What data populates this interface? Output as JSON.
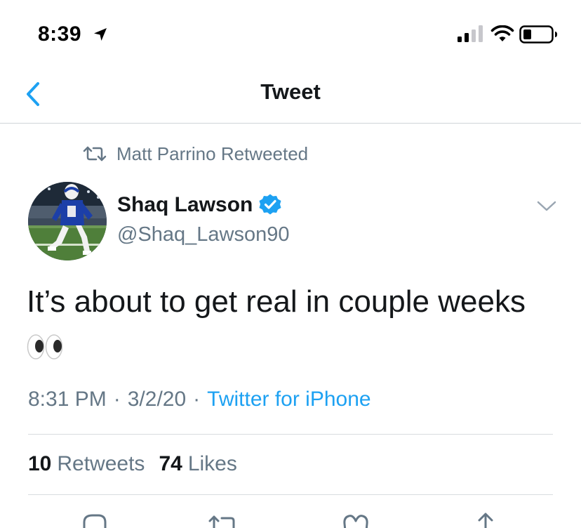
{
  "status_bar": {
    "time": "8:39"
  },
  "nav": {
    "title": "Tweet"
  },
  "retweet_context": {
    "text": "Matt Parrino Retweeted"
  },
  "tweet": {
    "author_name": "Shaq Lawson",
    "author_handle": "@Shaq_Lawson90",
    "text": "It’s about to get real in couple weeks",
    "emoji": "👀",
    "time": "8:31 PM",
    "separator": "·",
    "date": "3/2/20",
    "source": "Twitter for iPhone"
  },
  "stats": {
    "retweets_count": "10",
    "retweets_label": "Retweets",
    "likes_count": "74",
    "likes_label": "Likes"
  },
  "colors": {
    "accent": "#1da1f2",
    "secondary_text": "#657786",
    "primary_text": "#14171a",
    "verified": "#1da1f2"
  },
  "icons": [
    "location-arrow-icon",
    "signal-icon",
    "wifi-icon",
    "battery-icon",
    "back-chevron-icon",
    "retweet-icon",
    "verified-badge-icon",
    "chevron-down-icon",
    "eyes-emoji-icon",
    "reply-icon",
    "like-icon",
    "share-icon"
  ]
}
